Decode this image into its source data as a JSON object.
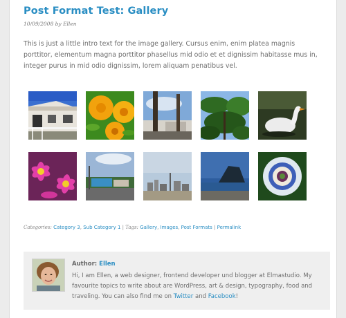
{
  "post": {
    "title": "Post Format Test: Gallery",
    "date": "10/09/2008",
    "by": "by",
    "author": "Ellen",
    "intro": "This is just a little intro text for the image gallery. Cursus enim, enim platea magnis porttitor, elementum magna porttitor phasellus mid odio et et dignissim habitasse mus in, integer purus in mid odio dignissim, lorem aliquam penatibus vel."
  },
  "gallery": {
    "images": [
      {
        "name": "house-photo"
      },
      {
        "name": "yellow-flowers-photo"
      },
      {
        "name": "palm-trees-photo"
      },
      {
        "name": "tropical-plants-photo"
      },
      {
        "name": "goose-photo"
      },
      {
        "name": "pink-flowers-photo"
      },
      {
        "name": "street-photo"
      },
      {
        "name": "city-skyline-photo"
      },
      {
        "name": "coastal-rock-photo"
      },
      {
        "name": "passion-flower-photo"
      }
    ]
  },
  "taxonomy": {
    "categories_label": "Categories:",
    "categories": [
      "Category 3",
      "Sub Category 1"
    ],
    "separator": "|",
    "tags_label": "Tags:",
    "tags": [
      "Gallery",
      "Images",
      "Post Formats"
    ],
    "permalink": "Permalink"
  },
  "author_box": {
    "label": "Author:",
    "name": "Ellen",
    "bio_text": "Hi, I am Ellen, a web designer, frontend developer und blogger at Elmastudio. My favourite topics to write about are WordPress, art & design, typography, food and traveling. You can also find me on",
    "twitter": "Twitter",
    "and": "and",
    "facebook": "Facebook",
    "end": "!"
  },
  "colors": {
    "link": "#2a8ec3",
    "text": "#6e6e6e",
    "author_bg": "#efefef"
  }
}
